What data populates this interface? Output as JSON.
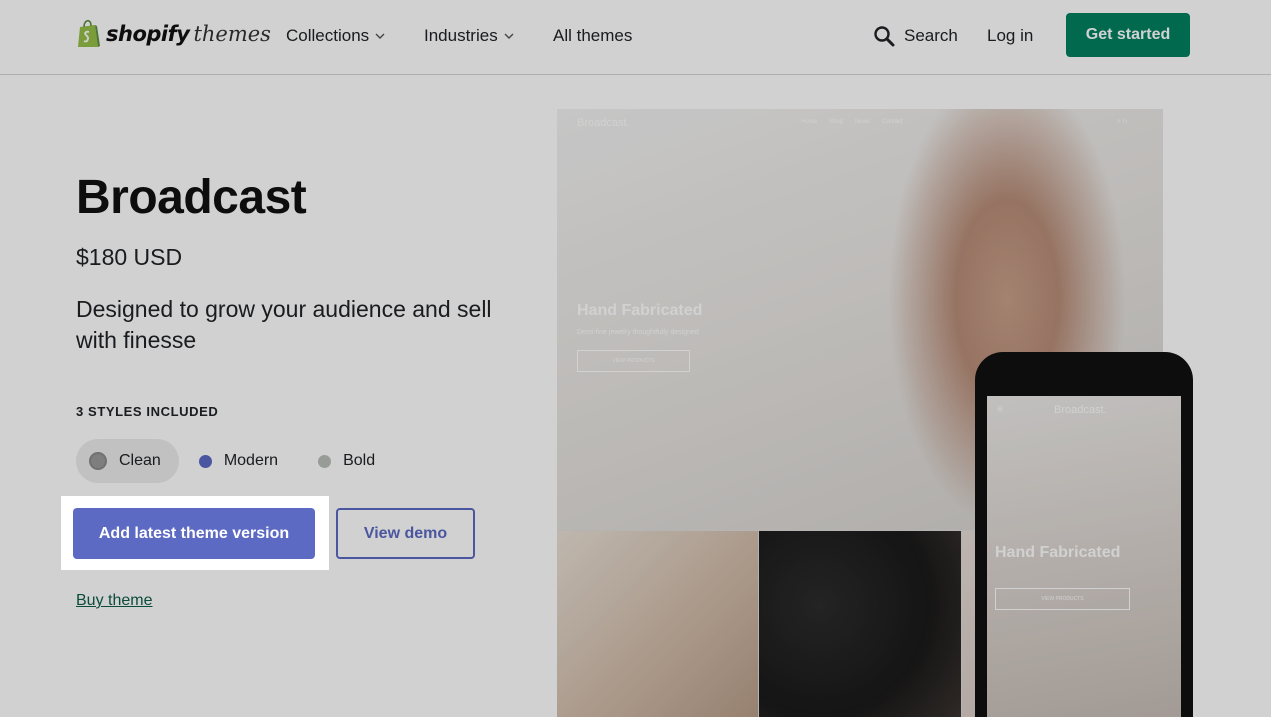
{
  "header": {
    "logo_text": "shopify",
    "logo_suffix": "themes",
    "nav": {
      "collections": "Collections",
      "industries": "Industries",
      "all_themes": "All themes",
      "search": "Search",
      "login": "Log in",
      "get_started": "Get started"
    }
  },
  "theme": {
    "title": "Broadcast",
    "price": "$180 USD",
    "tagline": "Designed to grow your audience and sell with finesse",
    "styles_label": "3 STYLES INCLUDED",
    "styles": [
      {
        "label": "Clean",
        "color": "#9a9a9a"
      },
      {
        "label": "Modern",
        "color": "#5c6ac4"
      },
      {
        "label": "Bold",
        "color": "#b9c0b8"
      }
    ],
    "add_button": "Add latest theme version",
    "demo_button": "View demo",
    "buy_link": "Buy theme"
  },
  "preview": {
    "brand": "Broadcast.",
    "nav": [
      "Home",
      "Shop",
      "News",
      "Contact"
    ],
    "hero_heading": "Hand Fabricated",
    "hero_sub": "Demi-fine jewelry thoughtfully designed",
    "hero_button": "VIEW PRODUCTS"
  },
  "colors": {
    "brand_green": "#008060",
    "accent_indigo": "#5c6ac4"
  }
}
